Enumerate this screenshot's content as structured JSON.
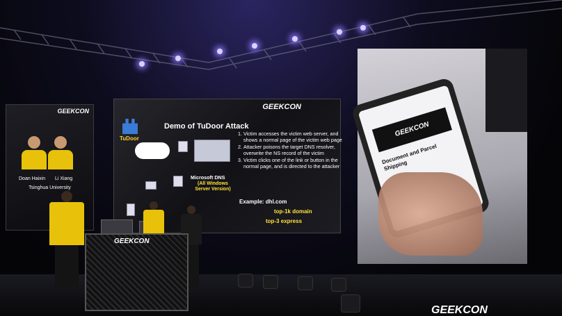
{
  "left_screen": {
    "logo": "GEEKCON",
    "name_left": "Doan Haixin",
    "name_right": "Li Xiang",
    "affiliation": "Tsinghua University"
  },
  "center_screen": {
    "logo": "GEEKCON",
    "brand": "TuDoor",
    "title": "Demo of TuDoor Attack",
    "steps": [
      "Victim accesses the victim web server, and shows a normal page of the victim web page",
      "Attacker poisons the target DNS resolver, overwrite the NS record of the victim",
      "Victim clicks one of the link or button in the normal page, and is directed to the attacker"
    ],
    "dns_label": "Microsoft DNS",
    "dns_sub": "(All Windows Server Version)",
    "example": "Example: dhl.com",
    "domain_rank": "top-1k domain",
    "express_rank": "top-3 express"
  },
  "right_screen": {
    "phone_logo": "GEEKCON",
    "phone_title": "Document and Parcel Shipping"
  },
  "podium": {
    "logo": "GEEKCON"
  },
  "stage_logo": "GEEKCON"
}
